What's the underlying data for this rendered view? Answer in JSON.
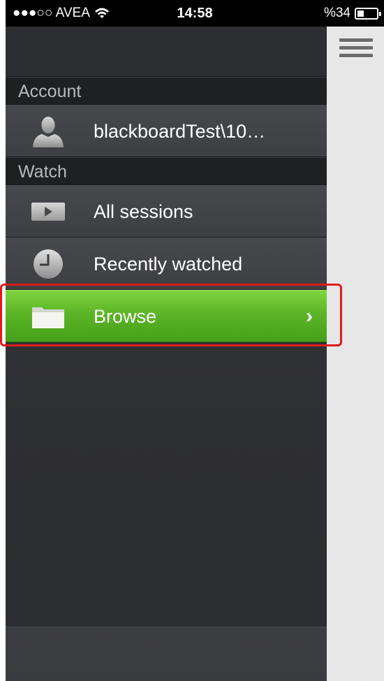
{
  "status_bar": {
    "carrier": "●●●○○ AVEA",
    "time": "14:58",
    "battery_text": "%34",
    "battery_level": 0.34
  },
  "menu": {
    "sections": [
      {
        "header": "Account",
        "items": [
          {
            "label": "blackboardTest\\10…",
            "icon": "user-silhouette-icon"
          }
        ]
      },
      {
        "header": "Watch",
        "items": [
          {
            "label": "All sessions",
            "icon": "play-video-icon"
          },
          {
            "label": "Recently watched",
            "icon": "clock-icon"
          },
          {
            "label": "Browse",
            "icon": "folder-icon",
            "selected": true,
            "chevron": "›"
          }
        ]
      }
    ]
  },
  "colors": {
    "accent_green": "#5cb526",
    "highlight_red": "#e11b1b",
    "menu_background": "#2e2f32"
  },
  "toolbar": {
    "menu_icon": "hamburger-menu-icon"
  }
}
